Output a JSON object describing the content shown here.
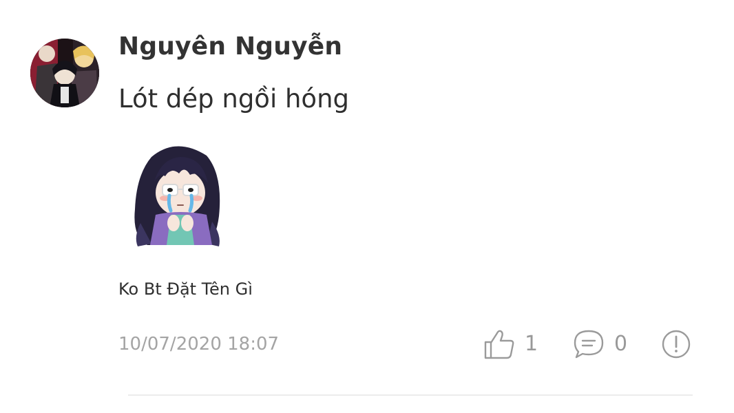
{
  "comment": {
    "author": "Nguyên Nguyễn",
    "text": "Lót dép ngồi hóng",
    "sticker_name": "Ko Bt Đặt Tên Gì",
    "timestamp": "10/07/2020 18:07",
    "likes": "1",
    "replies": "0"
  },
  "icons": {
    "avatar": "avatar-image",
    "sticker": "anime-girl-crying-sticker",
    "like": "thumbs-up-icon",
    "reply": "speech-bubble-icon",
    "report": "exclamation-circle-icon"
  },
  "colors": {
    "text": "#2f2f2f",
    "muted": "#a4a4a4",
    "divider": "#ececec"
  }
}
